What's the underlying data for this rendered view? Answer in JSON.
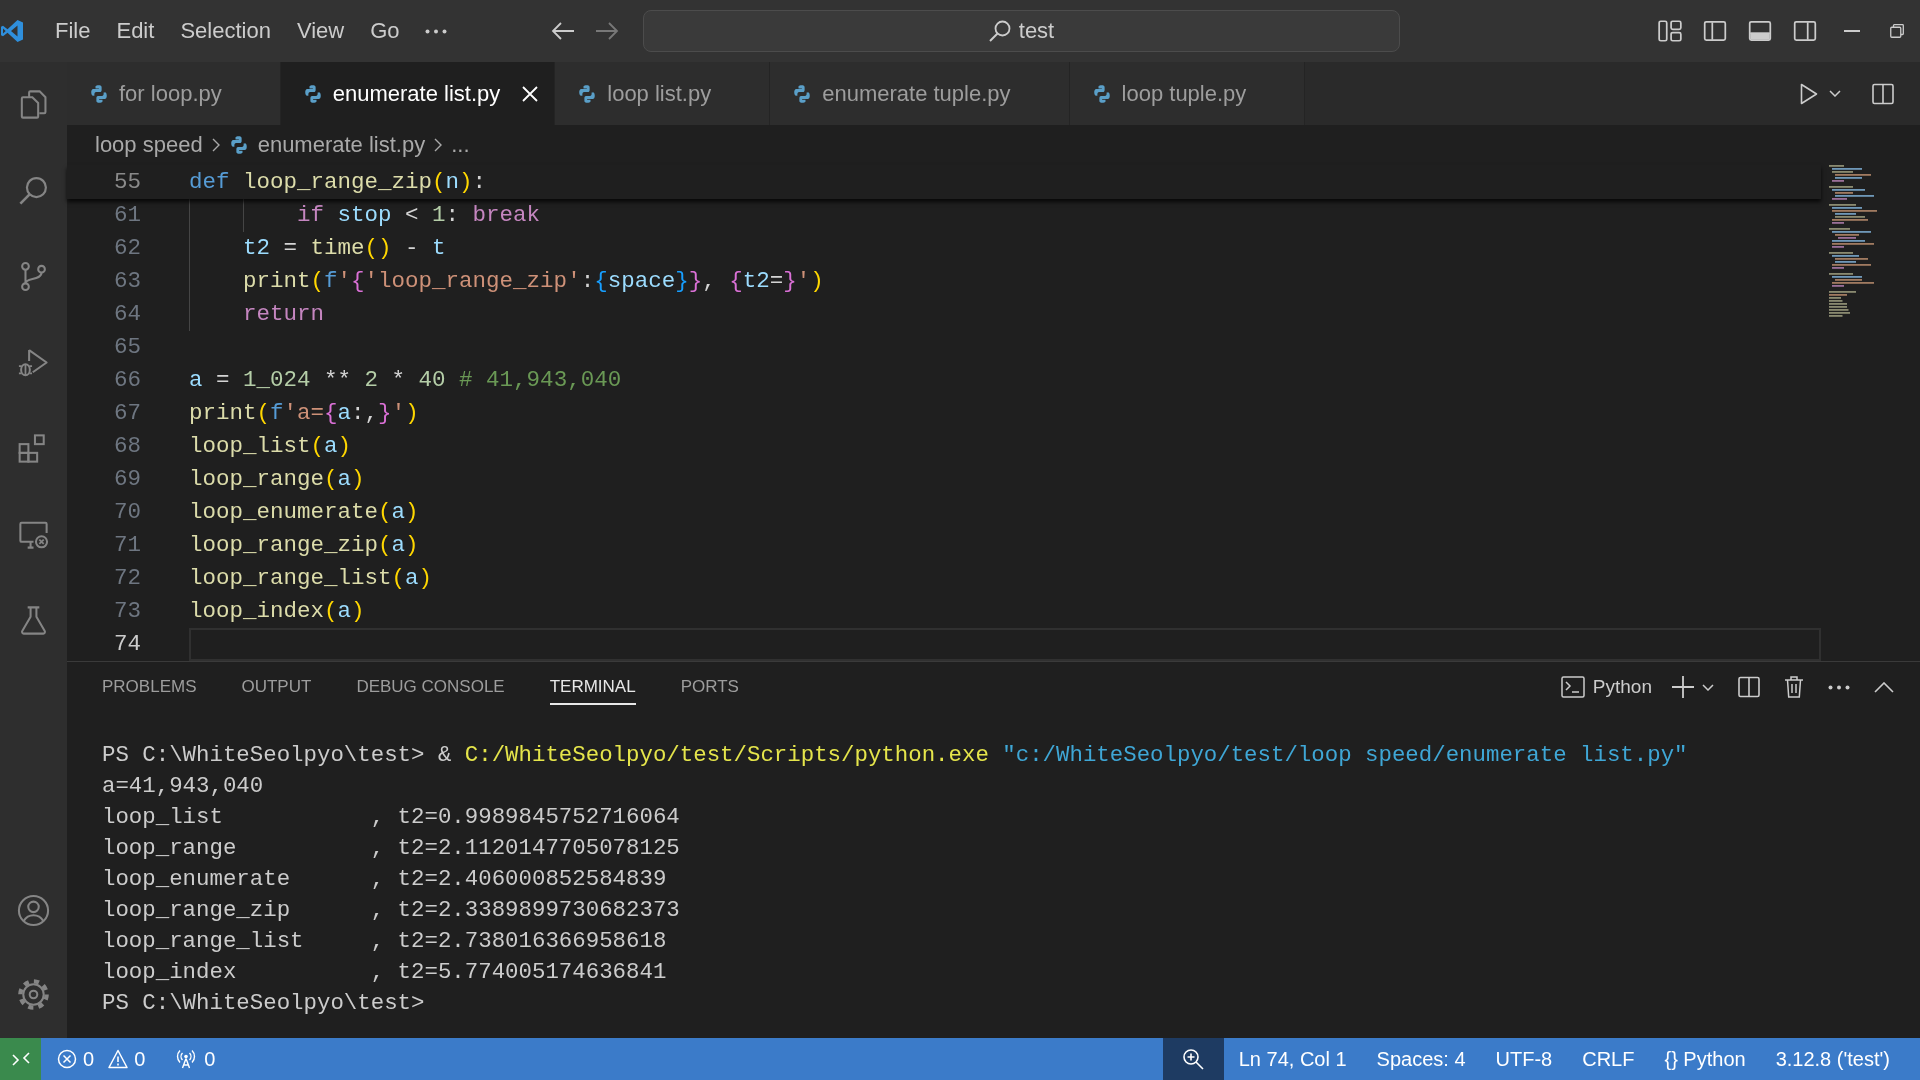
{
  "title_bar": {
    "menu": [
      "File",
      "Edit",
      "Selection",
      "View",
      "Go"
    ],
    "navigation": {
      "back_disabled": false,
      "forward_disabled": true
    },
    "command_center": "test",
    "layout_toggles": [
      {
        "kind": "sidebar",
        "on": false
      },
      {
        "kind": "panel",
        "on": true
      },
      {
        "kind": "secondary_sidebar",
        "on": false
      }
    ]
  },
  "editor_tabs": [
    {
      "label": "for loop.py",
      "selected": false
    },
    {
      "label": "enumerate list.py",
      "selected": true
    },
    {
      "label": "loop list.py",
      "selected": false
    },
    {
      "label": "enumerate tuple.py",
      "selected": false
    },
    {
      "label": "loop tuple.py",
      "selected": false
    }
  ],
  "breadcrumb": [
    {
      "label": "loop speed",
      "kind": "folder"
    },
    {
      "label": "enumerate list.py",
      "kind": "file"
    },
    {
      "label": "...",
      "kind": "symbol"
    }
  ],
  "editor": {
    "sticky": {
      "number": "55",
      "tokens": [
        {
          "text": "def",
          "kind": "keyword"
        },
        {
          "text": " loop_range_zip",
          "kind": "function"
        },
        {
          "text": "(",
          "kind": "bracket_gold"
        },
        {
          "text": "n",
          "kind": "variable"
        },
        {
          "text": ")",
          "kind": "bracket_gold"
        },
        {
          "text": ":",
          "kind": "operator"
        }
      ]
    },
    "lines": [
      {
        "number": "61",
        "current": false,
        "tokens": [
          {
            "text": "        if",
            "kind": "control"
          },
          {
            "text": " stop",
            "kind": "variable"
          },
          {
            "text": " < ",
            "kind": "operator"
          },
          {
            "text": "1",
            "kind": "number"
          },
          {
            "text": ": ",
            "kind": "operator"
          },
          {
            "text": "break",
            "kind": "control"
          }
        ]
      },
      {
        "number": "62",
        "current": false,
        "tokens": [
          {
            "text": "    t2",
            "kind": "variable"
          },
          {
            "text": " = ",
            "kind": "operator"
          },
          {
            "text": "time",
            "kind": "function"
          },
          {
            "text": "()",
            "kind": "bracket_gold"
          },
          {
            "text": " - ",
            "kind": "operator"
          },
          {
            "text": "t",
            "kind": "variable"
          }
        ]
      },
      {
        "number": "63",
        "current": false,
        "tokens": [
          {
            "text": "    print",
            "kind": "function"
          },
          {
            "text": "(",
            "kind": "bracket_gold"
          },
          {
            "text": "f",
            "kind": "keyword"
          },
          {
            "text": "'",
            "kind": "string"
          },
          {
            "text": "{",
            "kind": "bracket_pink"
          },
          {
            "text": "'loop_range_zip'",
            "kind": "string"
          },
          {
            "text": ":",
            "kind": "operator"
          },
          {
            "text": "{",
            "kind": "bracket_blue"
          },
          {
            "text": "space",
            "kind": "variable"
          },
          {
            "text": "}",
            "kind": "bracket_blue"
          },
          {
            "text": "}",
            "kind": "bracket_pink"
          },
          {
            "text": ", ",
            "kind": "operator"
          },
          {
            "text": "{",
            "kind": "bracket_pink"
          },
          {
            "text": "t2",
            "kind": "variable"
          },
          {
            "text": "=",
            "kind": "operator"
          },
          {
            "text": "}",
            "kind": "bracket_pink"
          },
          {
            "text": "'",
            "kind": "string"
          },
          {
            "text": ")",
            "kind": "bracket_gold"
          }
        ]
      },
      {
        "number": "64",
        "current": false,
        "tokens": [
          {
            "text": "    return",
            "kind": "control"
          }
        ]
      },
      {
        "number": "65",
        "current": false
      },
      {
        "number": "66",
        "current": false,
        "tokens": [
          {
            "text": "a",
            "kind": "variable"
          },
          {
            "text": " = ",
            "kind": "operator"
          },
          {
            "text": "1_024",
            "kind": "number"
          },
          {
            "text": " ** ",
            "kind": "operator"
          },
          {
            "text": "2",
            "kind": "number"
          },
          {
            "text": " * ",
            "kind": "operator"
          },
          {
            "text": "40",
            "kind": "number"
          },
          {
            "text": " # 41,943,040",
            "kind": "comment"
          }
        ]
      },
      {
        "number": "67",
        "current": false,
        "tokens": [
          {
            "text": "print",
            "kind": "function"
          },
          {
            "text": "(",
            "kind": "bracket_gold"
          },
          {
            "text": "f",
            "kind": "keyword"
          },
          {
            "text": "'a=",
            "kind": "string"
          },
          {
            "text": "{",
            "kind": "bracket_pink"
          },
          {
            "text": "a",
            "kind": "variable"
          },
          {
            "text": ":,",
            "kind": "operator"
          },
          {
            "text": "}",
            "kind": "bracket_pink"
          },
          {
            "text": "'",
            "kind": "string"
          },
          {
            "text": ")",
            "kind": "bracket_gold"
          }
        ]
      },
      {
        "number": "68",
        "current": false,
        "tokens": [
          {
            "text": "loop_list",
            "kind": "function"
          },
          {
            "text": "(",
            "kind": "bracket_gold"
          },
          {
            "text": "a",
            "kind": "variable"
          },
          {
            "text": ")",
            "kind": "bracket_gold"
          }
        ]
      },
      {
        "number": "69",
        "current": false,
        "tokens": [
          {
            "text": "loop_range",
            "kind": "function"
          },
          {
            "text": "(",
            "kind": "bracket_gold"
          },
          {
            "text": "a",
            "kind": "variable"
          },
          {
            "text": ")",
            "kind": "bracket_gold"
          }
        ]
      },
      {
        "number": "70",
        "current": false,
        "tokens": [
          {
            "text": "loop_enumerate",
            "kind": "function"
          },
          {
            "text": "(",
            "kind": "bracket_gold"
          },
          {
            "text": "a",
            "kind": "variable"
          },
          {
            "text": ")",
            "kind": "bracket_gold"
          }
        ]
      },
      {
        "number": "71",
        "current": false,
        "tokens": [
          {
            "text": "loop_range_zip",
            "kind": "function"
          },
          {
            "text": "(",
            "kind": "bracket_gold"
          },
          {
            "text": "a",
            "kind": "variable"
          },
          {
            "text": ")",
            "kind": "bracket_gold"
          }
        ]
      },
      {
        "number": "72",
        "current": false,
        "tokens": [
          {
            "text": "loop_range_list",
            "kind": "function"
          },
          {
            "text": "(",
            "kind": "bracket_gold"
          },
          {
            "text": "a",
            "kind": "variable"
          },
          {
            "text": ")",
            "kind": "bracket_gold"
          }
        ]
      },
      {
        "number": "73",
        "current": false,
        "tokens": [
          {
            "text": "loop_index",
            "kind": "function"
          },
          {
            "text": "(",
            "kind": "bracket_gold"
          },
          {
            "text": "a",
            "kind": "variable"
          },
          {
            "text": ")",
            "kind": "bracket_gold"
          }
        ]
      },
      {
        "number": "74",
        "current": true
      }
    ]
  },
  "panel": {
    "tabs": [
      {
        "label": "PROBLEMS",
        "selected": false
      },
      {
        "label": "OUTPUT",
        "selected": false
      },
      {
        "label": "DEBUG CONSOLE",
        "selected": false
      },
      {
        "label": "TERMINAL",
        "selected": true
      },
      {
        "label": "PORTS",
        "selected": false
      }
    ],
    "terminal_profile": "Python",
    "terminal": [
      {
        "tokens": [
          {
            "text": "PS C:\\WhiteSeolpyo\\test> & ",
            "kind": "plain"
          },
          {
            "text": "C:/WhiteSeolpyo/test/Scripts/python.exe",
            "kind": "command"
          },
          {
            "text": " \"c:/WhiteSeolpyo/test/loop speed/enumerate list.py\"",
            "kind": "string"
          }
        ]
      },
      {
        "tokens": [
          {
            "text": "a=41,943,040",
            "kind": "plain"
          }
        ]
      },
      {
        "tokens": [
          {
            "text": "loop_list           , t2=0.9989845752716064",
            "kind": "plain"
          }
        ]
      },
      {
        "tokens": [
          {
            "text": "loop_range          , t2=2.1120147705078125",
            "kind": "plain"
          }
        ]
      },
      {
        "tokens": [
          {
            "text": "loop_enumerate      , t2=2.406000852584839",
            "kind": "plain"
          }
        ]
      },
      {
        "tokens": [
          {
            "text": "loop_range_zip      , t2=2.3389899730682373",
            "kind": "plain"
          }
        ]
      },
      {
        "tokens": [
          {
            "text": "loop_range_list     , t2=2.738016366958618",
            "kind": "plain"
          }
        ]
      },
      {
        "tokens": [
          {
            "text": "loop_index          , t2=5.774005174636841",
            "kind": "plain"
          }
        ]
      },
      {
        "tokens": [
          {
            "text": "PS C:\\WhiteSeolpyo\\test>",
            "kind": "plain"
          }
        ]
      }
    ]
  },
  "status_bar": {
    "errors": "0",
    "warnings": "0",
    "ports": "0",
    "cursor": "Ln 74, Col 1",
    "indentation": "Spaces: 4",
    "encoding": "UTF-8",
    "line_ending": "CRLF",
    "language_icon": "{}",
    "language": "Python",
    "interpreter": "3.12.8 ('test')"
  }
}
